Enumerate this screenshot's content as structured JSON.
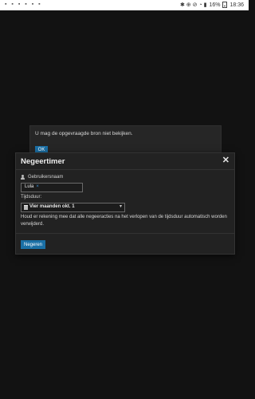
{
  "statusbar": {
    "left_icons": "▪ ▪ ▪ ▪ ▪ ▪",
    "right_icons": "✱ ⊕ ⊘ ◔ ▮",
    "battery": "16%",
    "time": "18:36"
  },
  "background_dialog": {
    "message": "U mag de opgevraagde bron niet bekijken.",
    "ok_label": "OK"
  },
  "modal": {
    "title": "Negeertimer",
    "close_glyph": "✕",
    "users_label": "Gebruikersnaam",
    "user_tag": "Lula",
    "remove_glyph": "×",
    "duration_label": "Tijdsduur:",
    "duration_value": "Vier maanden okt. 1",
    "notice": "Houd er rekening mee dat alle negeeracties na het verlopen van de tijdsduur automatisch worden verwijderd.",
    "ignore_button": "Negeren"
  },
  "colors": {
    "background": "#121212",
    "modal": "#222222",
    "accent": "#1a6fa5"
  }
}
